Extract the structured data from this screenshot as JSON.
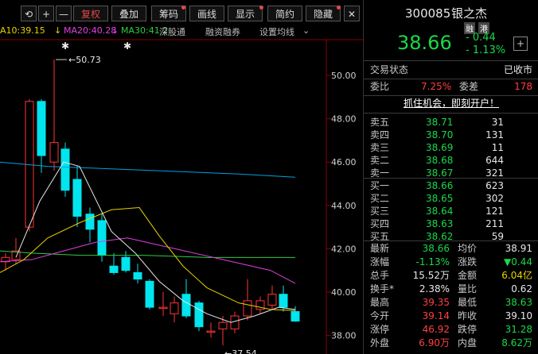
{
  "toolbar": {
    "buttons": [
      "⟲",
      "+",
      "—",
      "复权",
      "叠加",
      "筹码",
      "画线",
      "显示",
      "简约",
      "隐藏"
    ],
    "window_icons": [
      "▢",
      "✕"
    ]
  },
  "ma_legend": {
    "ma10": "A10:39.15",
    "ma20": "MA20:40.28",
    "ma30": "MA30:41.2",
    "links": [
      "深股通",
      "融资融券",
      "设置均线"
    ]
  },
  "chart": {
    "y_ticks": [
      "50.00",
      "48.00",
      "46.00",
      "44.00",
      "42.00",
      "40.00",
      "38.00"
    ],
    "high_label": "50.73",
    "low_label": "37.54",
    "star": "✱",
    "colors": {
      "up": "#ff3333",
      "down": "#00e5ee",
      "ma5": "#e6e6e6",
      "ma10": "#e6d200",
      "ma20": "#e040e0",
      "ma30": "#2ecc40",
      "ma60": "#00a0e0"
    }
  },
  "quote": {
    "code": "300085",
    "name": "银之杰",
    "badges": [
      "融",
      "港"
    ],
    "price": "38.66",
    "change": "- 0.44",
    "change_pct": "- 1.13%",
    "add_icon": "+"
  },
  "status": {
    "label": "交易状态",
    "value": "已收市"
  },
  "ratio": {
    "wb_label": "委比",
    "wb_value": "7.25%",
    "wc_label": "委差",
    "wc_value": "178"
  },
  "promo": "抓住机会，即刻开户！",
  "asks": [
    {
      "label": "卖五",
      "price": "38.71",
      "vol": "31"
    },
    {
      "label": "卖四",
      "price": "38.70",
      "vol": "131"
    },
    {
      "label": "卖三",
      "price": "38.69",
      "vol": "11"
    },
    {
      "label": "卖二",
      "price": "38.68",
      "vol": "644"
    },
    {
      "label": "卖一",
      "price": "38.67",
      "vol": "321"
    }
  ],
  "bids": [
    {
      "label": "买一",
      "price": "38.66",
      "vol": "623"
    },
    {
      "label": "买二",
      "price": "38.65",
      "vol": "302"
    },
    {
      "label": "买三",
      "price": "38.64",
      "vol": "121"
    },
    {
      "label": "买四",
      "price": "38.63",
      "vol": "211"
    },
    {
      "label": "买五",
      "price": "38.62",
      "vol": "59"
    }
  ],
  "stats": [
    {
      "l1": "最新",
      "v1": "38.66",
      "c1": "green",
      "l2": "均价",
      "v2": "38.91",
      "c2": "white"
    },
    {
      "l1": "涨幅",
      "v1": "-1.13%",
      "c1": "green",
      "l2": "涨跌",
      "v2": "▼0.44",
      "c2": "green"
    },
    {
      "l1": "总手",
      "v1": "15.52万",
      "c1": "white",
      "l2": "金额",
      "v2": "6.04亿",
      "c2": "yellow"
    },
    {
      "l1": "换手*",
      "v1": "2.38%",
      "c1": "white",
      "l2": "量比",
      "v2": "0.62",
      "c2": "white"
    },
    {
      "l1": "最高",
      "v1": "39.35",
      "c1": "red",
      "l2": "最低",
      "v2": "38.63",
      "c2": "green"
    },
    {
      "l1": "今开",
      "v1": "39.14",
      "c1": "red",
      "l2": "昨收",
      "v2": "39.10",
      "c2": "white"
    },
    {
      "l1": "涨停",
      "v1": "46.92",
      "c1": "red",
      "l2": "跌停",
      "v2": "31.28",
      "c2": "green"
    },
    {
      "l1": "外盘",
      "v1": "6.90万",
      "c1": "red",
      "l2": "内盘",
      "v2": "8.62万",
      "c2": "green"
    }
  ]
}
